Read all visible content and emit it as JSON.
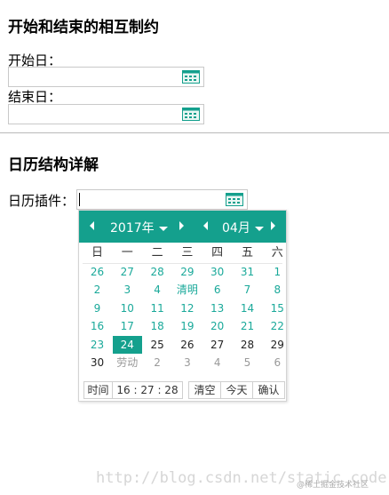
{
  "section1": {
    "title": "开始和结束的相互制约",
    "start_label": "开始日：",
    "end_label": "结束日：",
    "start_value": "",
    "end_value": ""
  },
  "section2": {
    "title": "日历结构详解",
    "plugin_label": "日历插件：",
    "plugin_value": ""
  },
  "picker": {
    "year": "2017年",
    "month": "04月",
    "weekdays": [
      "日",
      "一",
      "二",
      "三",
      "四",
      "五",
      "六"
    ],
    "weeks": [
      [
        {
          "t": "26",
          "k": "prev"
        },
        {
          "t": "27",
          "k": "prev"
        },
        {
          "t": "28",
          "k": "prev"
        },
        {
          "t": "29",
          "k": "prev"
        },
        {
          "t": "30",
          "k": "prev"
        },
        {
          "t": "31",
          "k": "prev"
        },
        {
          "t": "1",
          "k": "prev"
        }
      ],
      [
        {
          "t": "2",
          "k": "prev"
        },
        {
          "t": "3",
          "k": "prev"
        },
        {
          "t": "4",
          "k": "prev"
        },
        {
          "t": "清明",
          "k": "prev"
        },
        {
          "t": "6",
          "k": "prev"
        },
        {
          "t": "7",
          "k": "prev"
        },
        {
          "t": "8",
          "k": "prev"
        }
      ],
      [
        {
          "t": "9",
          "k": "prev"
        },
        {
          "t": "10",
          "k": "prev"
        },
        {
          "t": "11",
          "k": "prev"
        },
        {
          "t": "12",
          "k": "prev"
        },
        {
          "t": "13",
          "k": "prev"
        },
        {
          "t": "14",
          "k": "prev"
        },
        {
          "t": "15",
          "k": "prev"
        }
      ],
      [
        {
          "t": "16",
          "k": "prev"
        },
        {
          "t": "17",
          "k": "prev"
        },
        {
          "t": "18",
          "k": "prev"
        },
        {
          "t": "19",
          "k": "prev"
        },
        {
          "t": "20",
          "k": "prev"
        },
        {
          "t": "21",
          "k": "prev"
        },
        {
          "t": "22",
          "k": "prev"
        }
      ],
      [
        {
          "t": "23",
          "k": "prev"
        },
        {
          "t": "24",
          "k": "sel"
        },
        {
          "t": "25",
          "k": "cur"
        },
        {
          "t": "26",
          "k": "cur"
        },
        {
          "t": "27",
          "k": "cur"
        },
        {
          "t": "28",
          "k": "cur"
        },
        {
          "t": "29",
          "k": "cur"
        }
      ],
      [
        {
          "t": "30",
          "k": "cur"
        },
        {
          "t": "劳动",
          "k": "other"
        },
        {
          "t": "2",
          "k": "other"
        },
        {
          "t": "3",
          "k": "other"
        },
        {
          "t": "4",
          "k": "other"
        },
        {
          "t": "5",
          "k": "other"
        },
        {
          "t": "6",
          "k": "other"
        }
      ]
    ],
    "footer": {
      "time_label": "时间",
      "time_value": "16 : 27 : 28",
      "clear": "清空",
      "today": "今天",
      "confirm": "确认"
    }
  },
  "watermark": "http://blog.csdn.net/static_coder",
  "watermark_small": "@稀土掘金技术社区",
  "colors": {
    "accent": "#14a08d",
    "day_text": "#1aa99a"
  },
  "icons": [
    "calendar-icon",
    "prev-year-arrow",
    "next-year-arrow",
    "prev-month-arrow",
    "next-month-arrow",
    "dropdown-caret"
  ]
}
